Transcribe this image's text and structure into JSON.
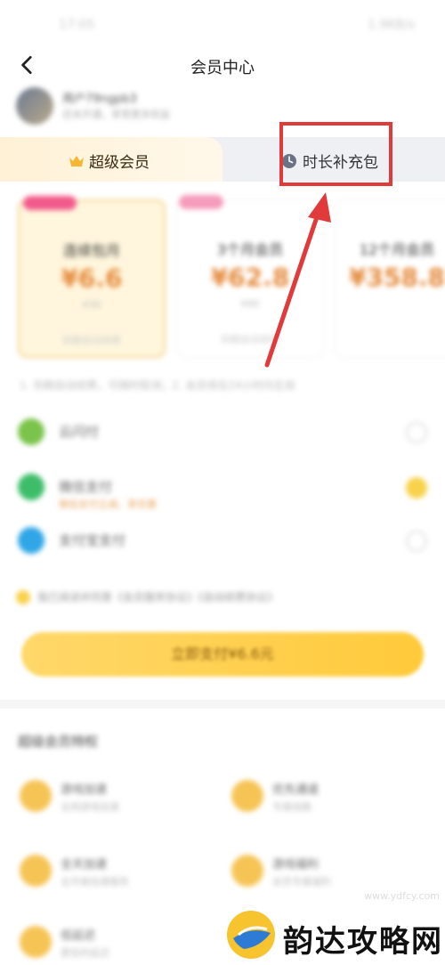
{
  "status_bar": {
    "time": "17:05",
    "right": "1.9KB/s"
  },
  "nav": {
    "title": "会员中心"
  },
  "user": {
    "name": "用户79ngpb3",
    "subtitle": "还未开通，享受更多权益"
  },
  "tabs": {
    "super_vip": "超级会员",
    "time_pack": "时长补充包"
  },
  "plans": [
    {
      "badge": "",
      "name": "连续包月",
      "price": "¥6.6",
      "original": "¥30",
      "note": "到期自动续费"
    },
    {
      "badge": "",
      "name": "3个月会员",
      "price": "¥62.8",
      "original": "¥90",
      "note": "到期自动续费"
    },
    {
      "badge": "",
      "name": "12个月会员",
      "price": "¥358.8",
      "original": "",
      "note": ""
    }
  ],
  "notice": "1. 到期自动续费，可随时取消；2. 会员将在24小时内生效",
  "payment": [
    {
      "label": "云闪付",
      "sub": "",
      "color": "#7bc34a",
      "selected": false
    },
    {
      "label": "微信支付",
      "sub": "微信支付立减，享优惠",
      "color": "#3dbd6a",
      "selected": true
    },
    {
      "label": "支付宝支付",
      "sub": "",
      "color": "#2fa6e6",
      "selected": false
    }
  ],
  "agreement": "我已阅读并同意《会员服务协议》《自动续费协议》",
  "pay_button": "立即支付¥6.6元",
  "benefits": {
    "title": "超级会员特权",
    "items": [
      {
        "title": "游戏加速",
        "sub": "全网游戏加速"
      },
      {
        "title": "优先通道",
        "sub": "专属线路"
      },
      {
        "title": "全天加速",
        "sub": "全天候加速服务"
      },
      {
        "title": "游戏福利",
        "sub": "会员专属福利"
      },
      {
        "title": "低延迟",
        "sub": "更低的延迟"
      }
    ]
  },
  "watermark": {
    "url": "www.ydfcy.com",
    "brand": "韵达攻略网"
  },
  "colors": {
    "highlight": "#e03a3a",
    "accent": "#f8d24a"
  }
}
